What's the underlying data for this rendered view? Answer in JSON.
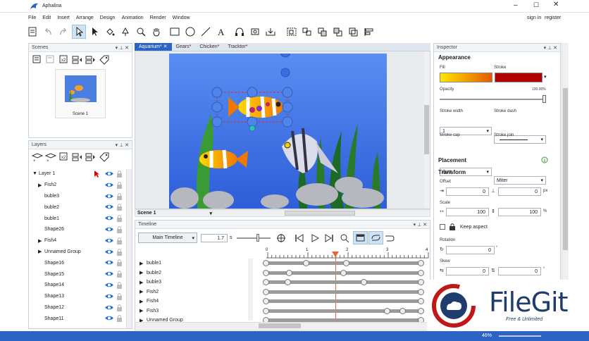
{
  "app": {
    "title": "Aphalina",
    "signin": "sign in",
    "register": "register"
  },
  "menu": [
    "File",
    "Edit",
    "Insert",
    "Arrange",
    "Design",
    "Animation",
    "Render",
    "Window"
  ],
  "scenes": {
    "title": "Scenes",
    "thumb_label": "Scene 1"
  },
  "layers": {
    "title": "Layers",
    "items": [
      {
        "label": "Layer 1",
        "indent": 0,
        "arrow": "down"
      },
      {
        "label": "Fish2",
        "indent": 1,
        "arrow": "right"
      },
      {
        "label": "buble3",
        "indent": 1,
        "arrow": ""
      },
      {
        "label": "buble2",
        "indent": 1,
        "arrow": ""
      },
      {
        "label": "buble1",
        "indent": 1,
        "arrow": ""
      },
      {
        "label": "Shape26",
        "indent": 1,
        "arrow": ""
      },
      {
        "label": "Fish4",
        "indent": 1,
        "arrow": "right"
      },
      {
        "label": "Unnamed Group",
        "indent": 1,
        "arrow": "right"
      },
      {
        "label": "Shape16",
        "indent": 1,
        "arrow": ""
      },
      {
        "label": "Shape15",
        "indent": 1,
        "arrow": ""
      },
      {
        "label": "Shape14",
        "indent": 1,
        "arrow": ""
      },
      {
        "label": "Shape13",
        "indent": 1,
        "arrow": ""
      },
      {
        "label": "Shape12",
        "indent": 1,
        "arrow": ""
      },
      {
        "label": "Shape11",
        "indent": 1,
        "arrow": ""
      }
    ]
  },
  "doc_tabs": [
    "Aquarium*",
    "Gears*",
    "Chicken*",
    "Tracktor*"
  ],
  "canvas": {
    "scene_select": "Scene 1"
  },
  "timeline": {
    "title": "Timeline",
    "main": "Main Timeline",
    "time": "1.7",
    "unit": "s",
    "ticks": [
      "0",
      "1",
      "2",
      "3",
      "4"
    ],
    "rows": [
      "buble1",
      "buble2",
      "buble3",
      "Fish2",
      "Fish4",
      "Fish3",
      "Unnamed Group"
    ],
    "keys": [
      [
        0.0,
        0.26,
        0.52,
        1.0
      ],
      [
        0.0,
        0.15,
        0.5,
        1.0
      ],
      [
        0.0,
        0.14,
        0.63,
        1.0
      ],
      [
        0.0,
        1.0
      ],
      [
        0.0,
        1.0
      ],
      [
        0.0,
        0.78,
        0.88,
        1.0
      ],
      [
        0.0,
        1.0
      ]
    ]
  },
  "inspector": {
    "title": "Inspector",
    "appearance": "Appearance",
    "fill": "Fill",
    "stroke": "Stroke",
    "opacity": "Opacity",
    "opacity_val": "100.00%",
    "stroke_width": "Stroke width",
    "stroke_width_val": "1",
    "stroke_dash": "Stroke dash",
    "stroke_cap": "Stroke cap",
    "stroke_cap_val": "Butt",
    "stroke_join": "Stroke join",
    "stroke_join_val": "Miter",
    "placement": "Placement",
    "transform": "Transform",
    "offset": "Offset",
    "offset_x": "0",
    "offset_y": "0",
    "px": "px",
    "scale": "Scale",
    "scale_x": "100",
    "scale_y": "100",
    "pct": "%",
    "keep_aspect": "Keep aspect",
    "rotation": "Rotation",
    "rotation_val": "0",
    "skew": "Skew",
    "skew_x": "0",
    "skew_y": "0",
    "deg": "°"
  },
  "watermark": {
    "brand": "FileGit",
    "tag": "Free & Unlimited"
  },
  "status": {
    "zoom": "46%"
  },
  "colors": {
    "accent": "#2d63c4",
    "fill_from": "#ffe600",
    "fill_to": "#e25b00",
    "stroke": "#b00000"
  }
}
